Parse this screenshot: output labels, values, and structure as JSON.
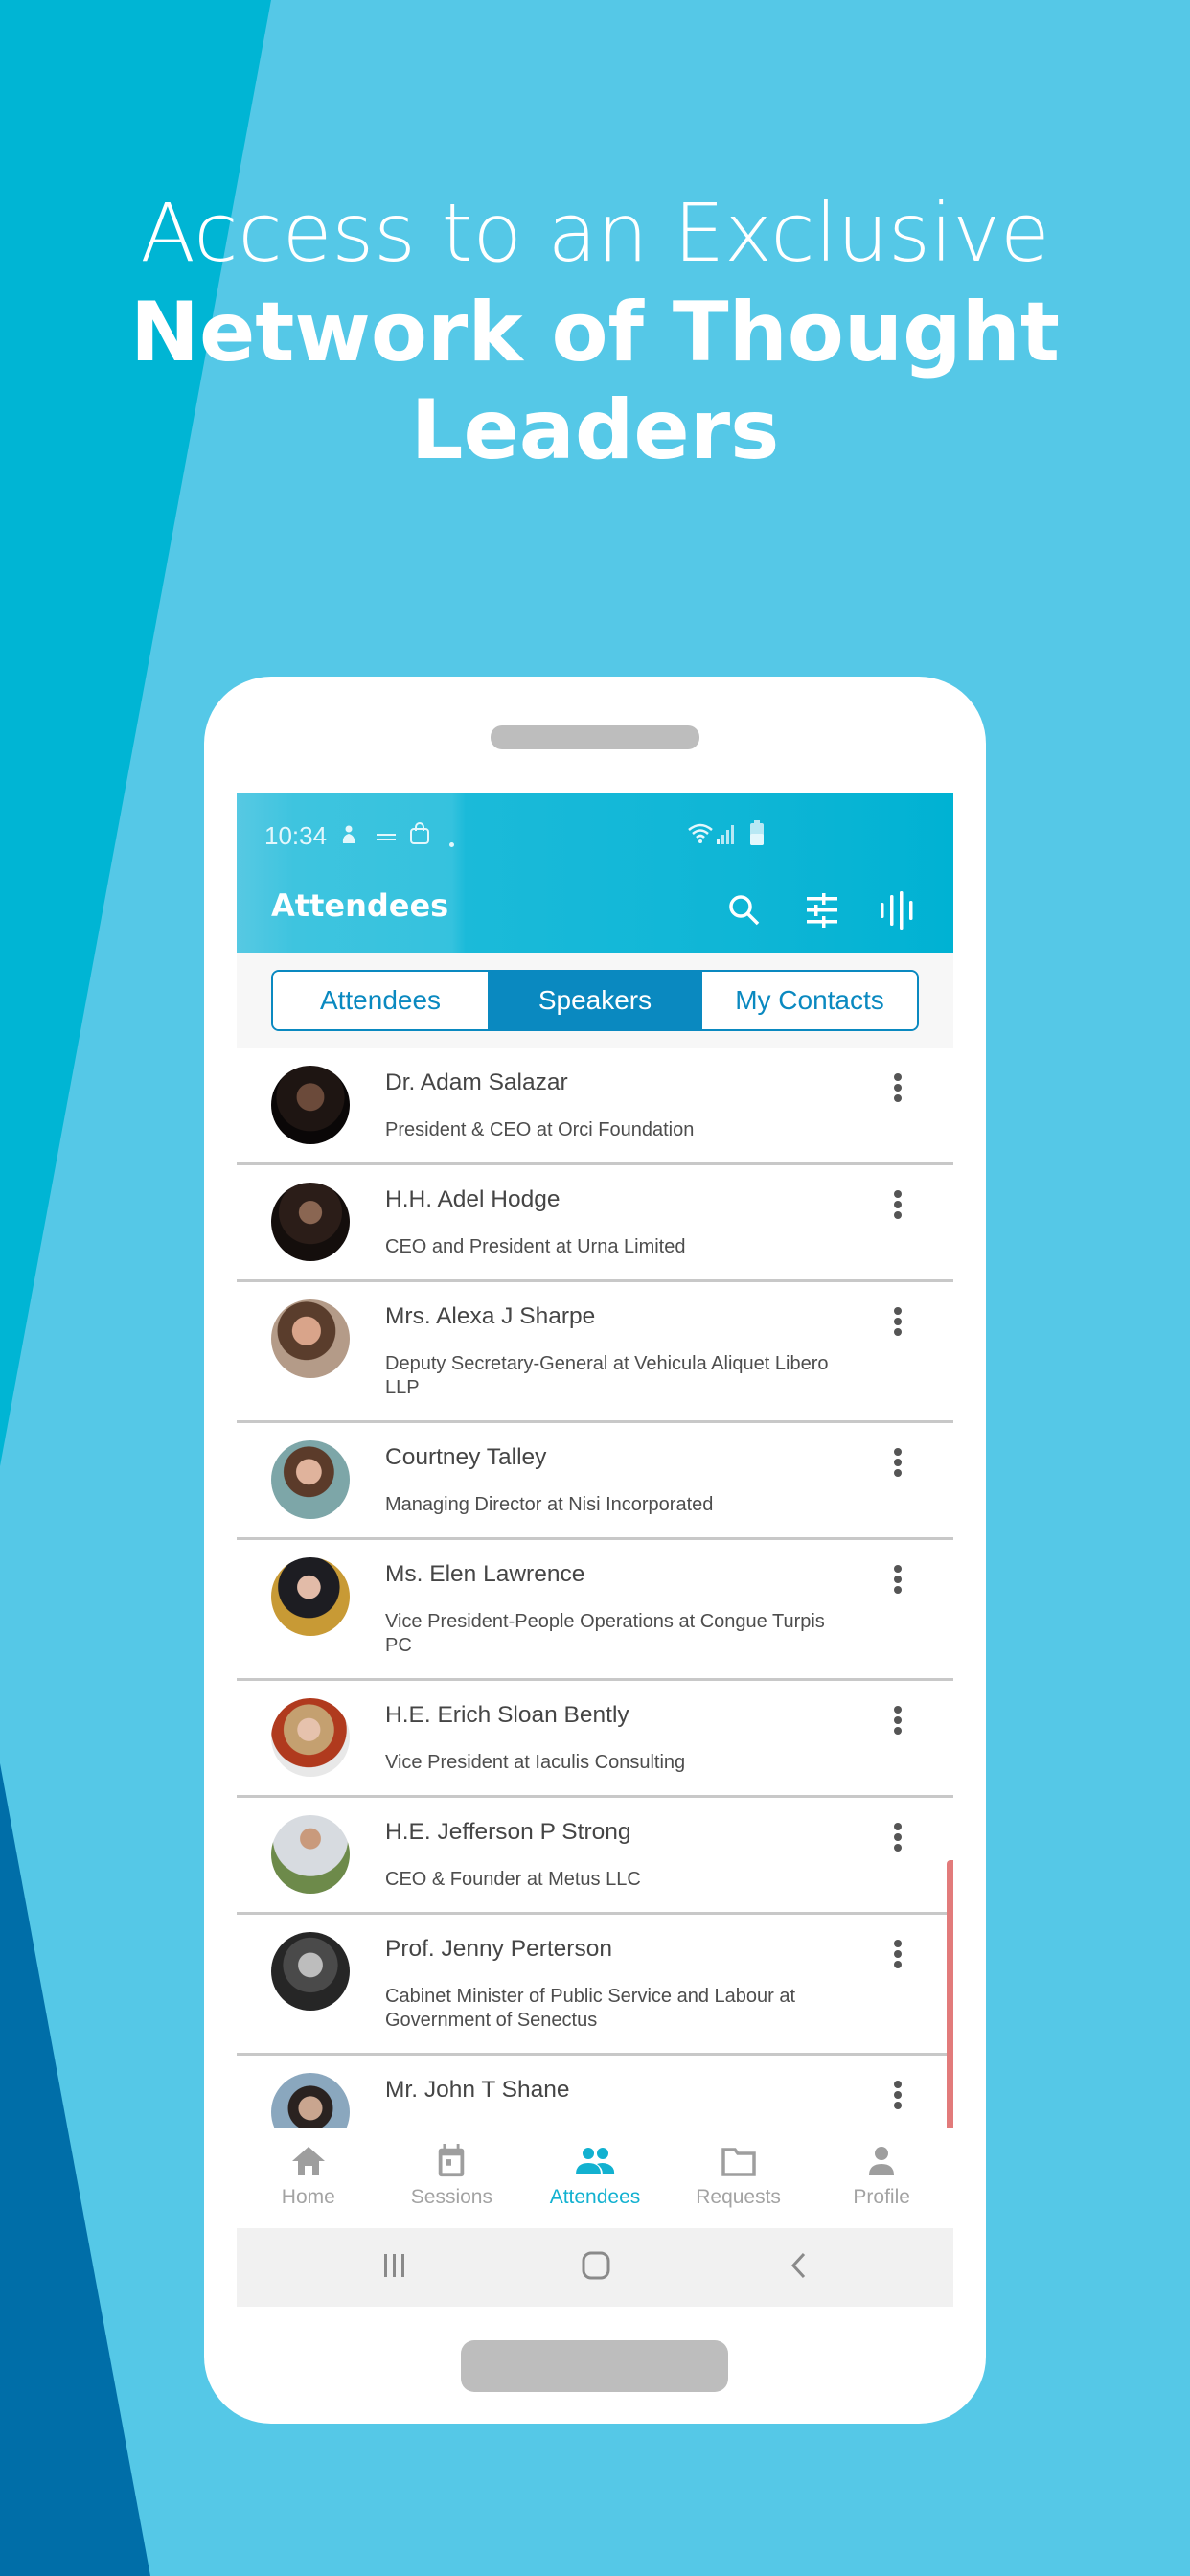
{
  "promo": {
    "line1": "Access to an Exclusive",
    "line2": "Network of Thought",
    "line3": "Leaders"
  },
  "colors": {
    "background": "#55c8e7",
    "teal_shape": "#00b5d4",
    "dark_shape": "#006ea8",
    "accent": "#0a89c0",
    "nav_active": "#12b1d0",
    "scrollbar": "#e27b7b"
  },
  "statusbar": {
    "time": "10:34",
    "icons": [
      "baby-app-icon",
      "what-to-expect-icon",
      "shopping-bag-icon",
      "dot-icon",
      "wifi-icon",
      "signal-icon",
      "battery-icon"
    ]
  },
  "appbar": {
    "title": "Attendees",
    "actions": [
      "search-icon",
      "filter-sliders-icon",
      "voice-wave-icon"
    ]
  },
  "segments": {
    "items": [
      "Attendees",
      "Speakers",
      "My Contacts"
    ],
    "selected": "Speakers"
  },
  "speakers": [
    {
      "name": "Dr. Adam Salazar",
      "title": "President & CEO at Orci Foundation"
    },
    {
      "name": "H.H. Adel Hodge",
      "title": "CEO and President at Urna Limited"
    },
    {
      "name": "Mrs. Alexa J Sharpe",
      "title": "Deputy Secretary-General at Vehicula Aliquet Libero LLP"
    },
    {
      "name": "Courtney Talley",
      "title": "Managing Director at Nisi Incorporated"
    },
    {
      "name": "Ms. Elen Lawrence",
      "title": "Vice President-People Operations at Congue Turpis PC"
    },
    {
      "name": "H.E. Erich Sloan Bently",
      "title": "Vice President at Iaculis Consulting"
    },
    {
      "name": "H.E. Jefferson P Strong",
      "title": "CEO & Founder at Metus LLC"
    },
    {
      "name": "Prof. Jenny Perterson",
      "title": "Cabinet Minister of Public Service and Labour at Government of Senectus"
    },
    {
      "name": "Mr. John T Shane",
      "title": ""
    }
  ],
  "bottom_nav": {
    "items": [
      "Home",
      "Sessions",
      "Attendees",
      "Requests",
      "Profile"
    ],
    "active": "Attendees"
  },
  "system_nav": [
    "recent-apps-icon",
    "home-icon",
    "back-icon"
  ]
}
